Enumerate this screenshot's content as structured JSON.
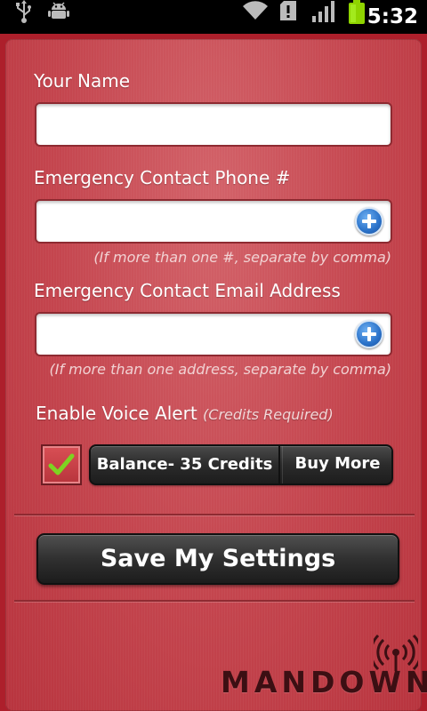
{
  "status_bar": {
    "icons": [
      "usb-icon",
      "android-debug-icon",
      "wifi-icon",
      "sd-card-icon",
      "signal-icon",
      "battery-icon"
    ],
    "time": "5:32"
  },
  "form": {
    "name_label": "Your Name",
    "name_value": "",
    "phone_label": "Emergency Contact Phone #",
    "phone_value": "",
    "phone_hint": "(If more than one #, separate by comma)",
    "email_label": "Emergency Contact Email Address",
    "email_value": "",
    "email_hint": "(If more than one address, separate by comma)",
    "voice_alert_label": "Enable Voice Alert",
    "voice_alert_note": "(Credits Required)",
    "voice_alert_checked": true,
    "balance_label": "Balance- 35 Credits",
    "buy_more_label": "Buy More",
    "save_label": "Save My Settings"
  },
  "branding": {
    "logo_text": "MANDOWN",
    "logo_icon": "broadcast-icon"
  },
  "colors": {
    "panel_red": "#c4454e",
    "button_dark": "#2b2b2b",
    "add_blue": "#2a72c9",
    "check_green": "#7ed321"
  }
}
